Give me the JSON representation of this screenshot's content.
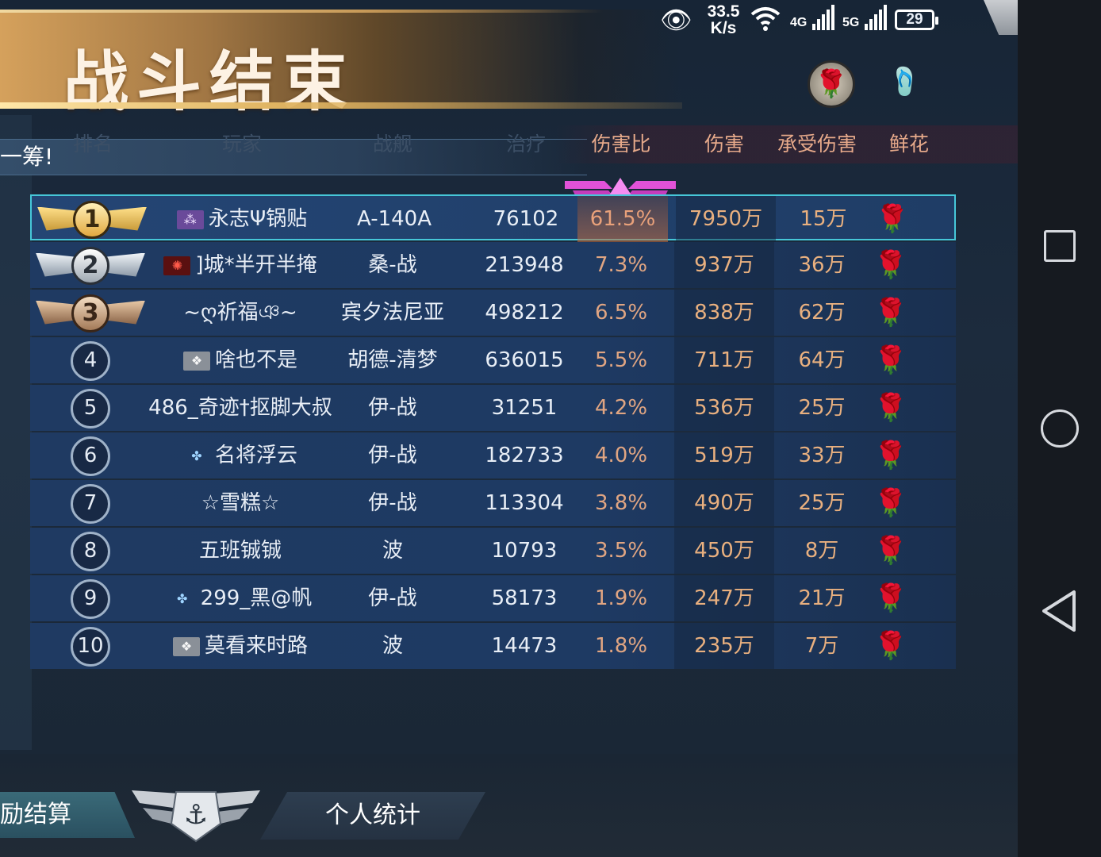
{
  "title": "战斗结束",
  "status_bar": {
    "speed_value": "33.5",
    "speed_unit": "K/s",
    "net1": "4G",
    "net2": "5G",
    "battery": "29"
  },
  "chat_text": "一筹!",
  "headers": {
    "rank": "排名",
    "player": "玩家",
    "ship": "战舰",
    "heal": "治疗",
    "ratio": "伤害比",
    "damage": "伤害",
    "taken": "承受伤害",
    "flower": "鲜花"
  },
  "rows": [
    {
      "rank": "1",
      "player": "永志Ψ锅贴",
      "ship": "A-140A",
      "heal": "76102",
      "ratio": "61.5%",
      "damage": "7950万",
      "taken": "15万"
    },
    {
      "rank": "2",
      "player": "]城*半开半掩",
      "ship": "桑-战",
      "heal": "213948",
      "ratio": "7.3%",
      "damage": "937万",
      "taken": "36万"
    },
    {
      "rank": "3",
      "player": "~ღ祈福ঞ~",
      "ship": "宾夕法尼亚",
      "heal": "498212",
      "ratio": "6.5%",
      "damage": "838万",
      "taken": "62万"
    },
    {
      "rank": "4",
      "player": "啥也不是",
      "ship": "胡德-清梦",
      "heal": "636015",
      "ratio": "5.5%",
      "damage": "711万",
      "taken": "64万"
    },
    {
      "rank": "5",
      "player": "486_奇迹†抠脚大叔",
      "ship": "伊-战",
      "heal": "31251",
      "ratio": "4.2%",
      "damage": "536万",
      "taken": "25万"
    },
    {
      "rank": "6",
      "player": "名将浮云",
      "ship": "伊-战",
      "heal": "182733",
      "ratio": "4.0%",
      "damage": "519万",
      "taken": "33万"
    },
    {
      "rank": "7",
      "player": "☆雪糕☆",
      "ship": "伊-战",
      "heal": "113304",
      "ratio": "3.8%",
      "damage": "490万",
      "taken": "25万"
    },
    {
      "rank": "8",
      "player": "五班铖铖",
      "ship": "波",
      "heal": "10793",
      "ratio": "3.5%",
      "damage": "450万",
      "taken": "8万"
    },
    {
      "rank": "9",
      "player": "299_黑@帆",
      "ship": "伊-战",
      "heal": "58173",
      "ratio": "1.9%",
      "damage": "247万",
      "taken": "21万"
    },
    {
      "rank": "10",
      "player": "莫看来时路",
      "ship": "波",
      "heal": "14473",
      "ratio": "1.8%",
      "damage": "235万",
      "taken": "7万"
    }
  ],
  "tabs": {
    "left": "励结算",
    "right": "个人统计"
  },
  "icons": {
    "eye": "eye-icon",
    "wifi": "wifi-icon",
    "close": "close-icon",
    "rose": "rose-icon",
    "slippers": "slippers-icon"
  }
}
